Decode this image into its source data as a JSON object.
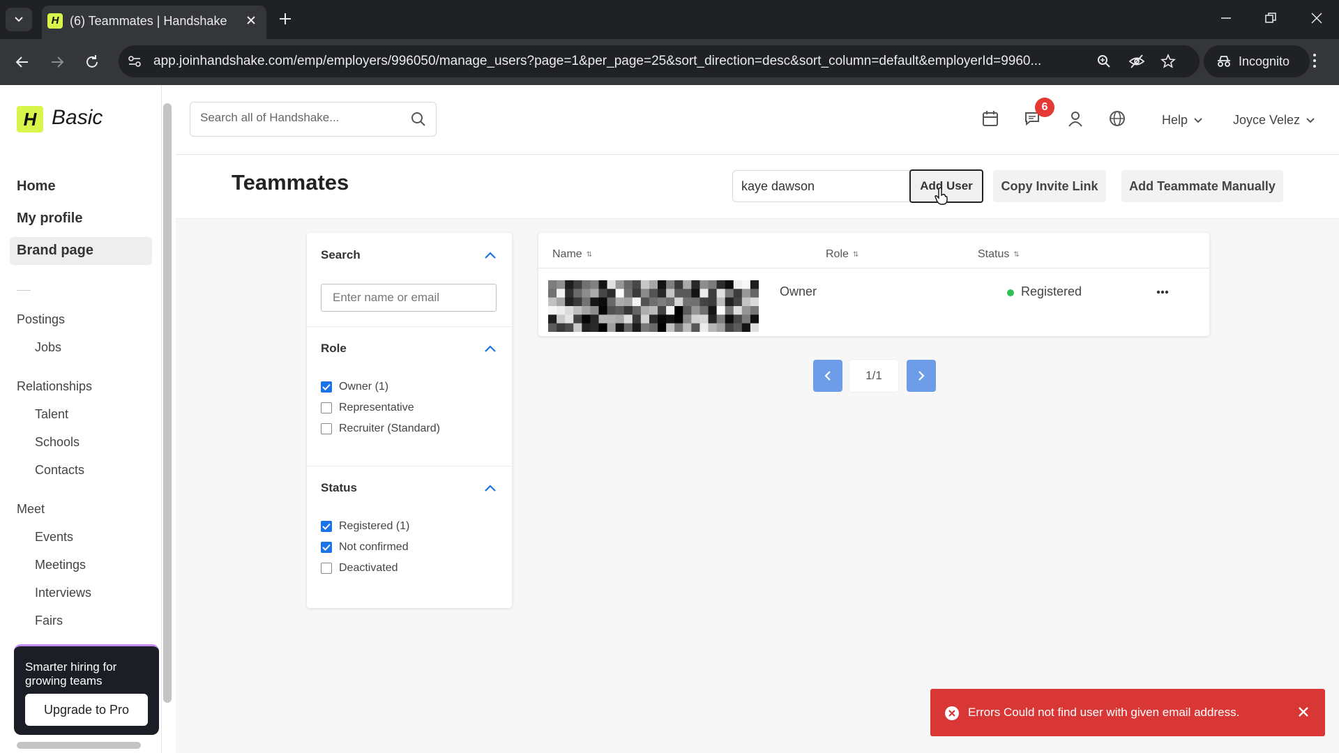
{
  "browser": {
    "tab_title": "(6) Teammates | Handshake",
    "favicon_letter": "H",
    "url": "app.joinhandshake.com/emp/employers/996050/manage_users?page=1&per_page=25&sort_direction=desc&sort_column=default&employerId=9960...",
    "incognito_label": "Incognito"
  },
  "brand": {
    "logo_letter": "H",
    "plan_label": "Basic",
    "accent": "#d7f54a"
  },
  "sidebar": {
    "primary": [
      {
        "label": "Home"
      },
      {
        "label": "My profile"
      },
      {
        "label": "Brand page",
        "active": true
      }
    ],
    "sections": [
      {
        "label": "Postings",
        "items": [
          "Jobs"
        ]
      },
      {
        "label": "Relationships",
        "items": [
          "Talent",
          "Schools",
          "Contacts"
        ]
      },
      {
        "label": "Meet",
        "items": [
          "Events",
          "Meetings",
          "Interviews",
          "Fairs"
        ]
      }
    ],
    "promo": {
      "text": "Smarter hiring for growing teams",
      "button": "Upgrade to Pro"
    }
  },
  "topbar": {
    "search_placeholder": "Search all of Handshake...",
    "notifications_count": "6",
    "help_label": "Help",
    "user_name": "Joyce Velez"
  },
  "header": {
    "title": "Teammates",
    "invite_value": "kaye dawson",
    "add_user_label": "Add User",
    "copy_invite_label": "Copy Invite Link",
    "add_manually_label": "Add Teammate Manually"
  },
  "filters": {
    "search": {
      "title": "Search",
      "placeholder": "Enter name or email"
    },
    "role": {
      "title": "Role",
      "options": [
        {
          "label": "Owner (1)",
          "checked": true
        },
        {
          "label": "Representative",
          "checked": false
        },
        {
          "label": "Recruiter (Standard)",
          "checked": false
        }
      ]
    },
    "status": {
      "title": "Status",
      "options": [
        {
          "label": "Registered (1)",
          "checked": true
        },
        {
          "label": "Not confirmed",
          "checked": true
        },
        {
          "label": "Deactivated",
          "checked": false
        }
      ]
    }
  },
  "table": {
    "columns": [
      "Name",
      "Role",
      "Status"
    ],
    "rows": [
      {
        "name": "",
        "role": "Owner",
        "status": "Registered",
        "status_color": "#2fbf52"
      }
    ]
  },
  "pagination": {
    "label": "1/1"
  },
  "toast": {
    "message": "Errors Could not find user with given email address.",
    "color": "#d93636"
  },
  "icons": {
    "search": "search-icon",
    "calendar": "calendar-icon",
    "messages": "messages-icon",
    "person": "person-icon",
    "globe": "globe-icon",
    "chevron": "chevron-down-icon",
    "ellipsis": "ellipsis-icon",
    "error": "error-circle-icon",
    "close": "close-icon"
  }
}
